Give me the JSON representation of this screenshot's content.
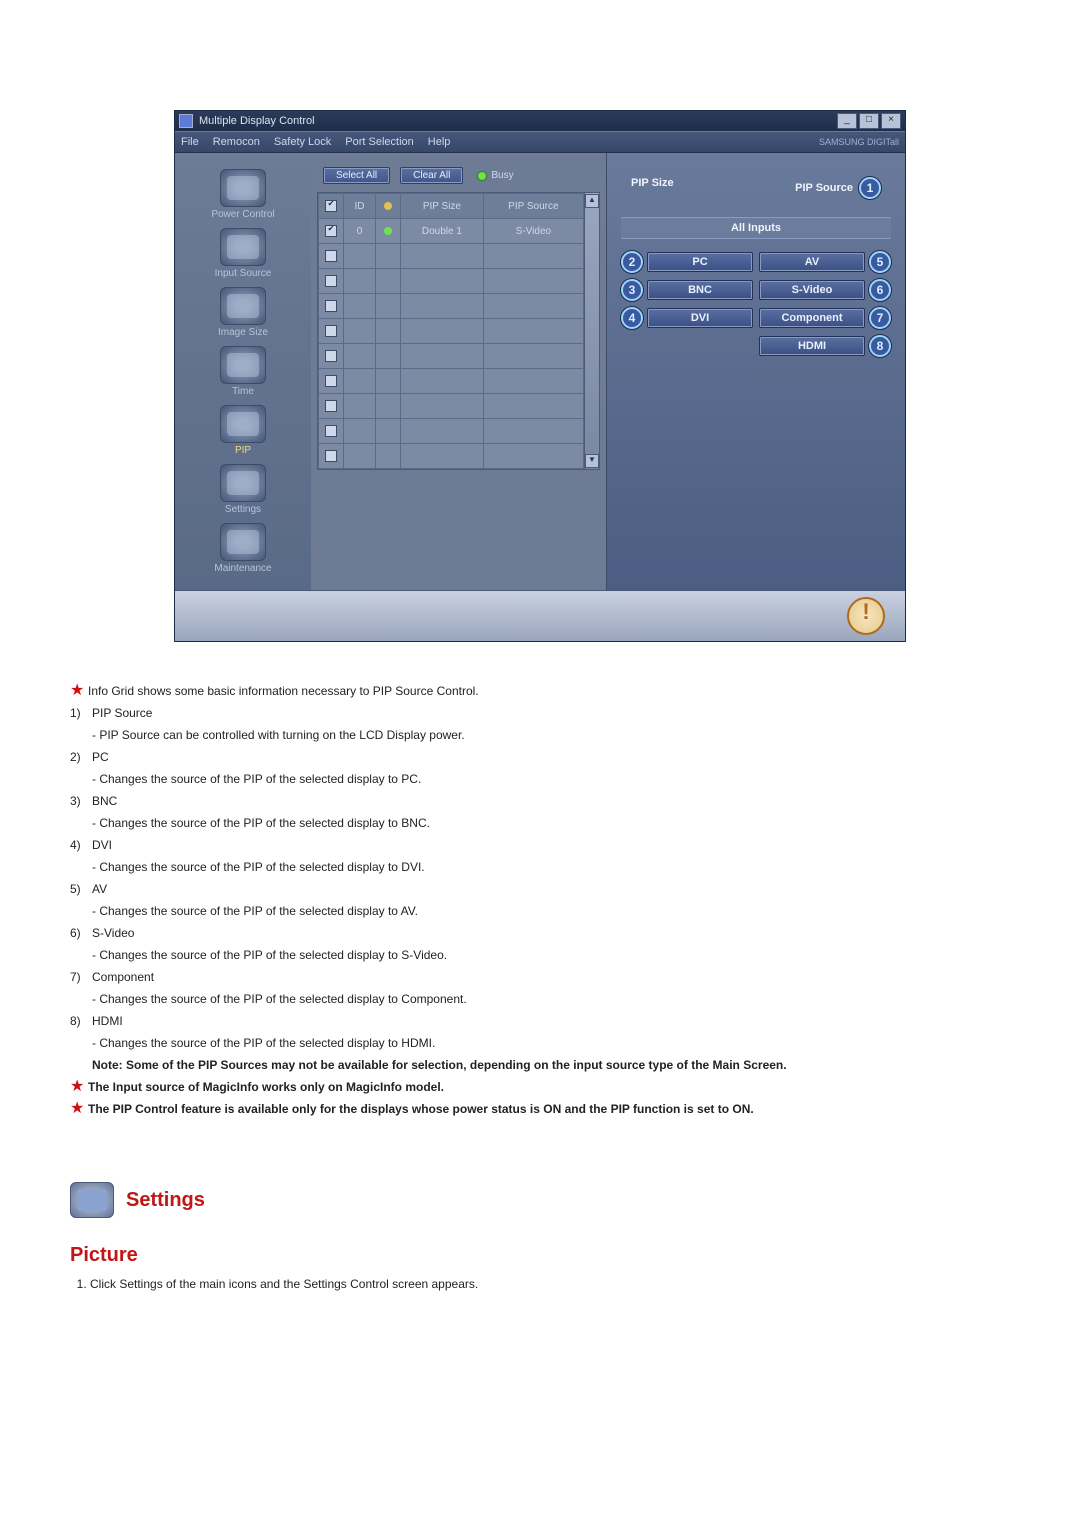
{
  "app": {
    "title": "Multiple Display Control",
    "menus": [
      "File",
      "Remocon",
      "Safety Lock",
      "Port Selection",
      "Help"
    ],
    "brand": "SAMSUNG DIGITall"
  },
  "sidebar": {
    "items": [
      {
        "label": "Power Control"
      },
      {
        "label": "Input Source"
      },
      {
        "label": "Image Size"
      },
      {
        "label": "Time"
      },
      {
        "label": "PIP"
      },
      {
        "label": "Settings"
      },
      {
        "label": "Maintenance"
      }
    ]
  },
  "toolbar": {
    "select_all": "Select All",
    "clear_all": "Clear All",
    "busy": "Busy"
  },
  "grid": {
    "headers": [
      "",
      "ID",
      "",
      "PIP Size",
      "PIP Source"
    ],
    "rows": [
      {
        "checked": true,
        "id": "0",
        "status": "green",
        "size": "Double 1",
        "source": "S-Video"
      },
      {
        "checked": false,
        "id": "",
        "status": "",
        "size": "",
        "source": ""
      },
      {
        "checked": false,
        "id": "",
        "status": "",
        "size": "",
        "source": ""
      },
      {
        "checked": false,
        "id": "",
        "status": "",
        "size": "",
        "source": ""
      },
      {
        "checked": false,
        "id": "",
        "status": "",
        "size": "",
        "source": ""
      },
      {
        "checked": false,
        "id": "",
        "status": "",
        "size": "",
        "source": ""
      },
      {
        "checked": false,
        "id": "",
        "status": "",
        "size": "",
        "source": ""
      },
      {
        "checked": false,
        "id": "",
        "status": "",
        "size": "",
        "source": ""
      },
      {
        "checked": false,
        "id": "",
        "status": "",
        "size": "",
        "source": ""
      },
      {
        "checked": false,
        "id": "",
        "status": "",
        "size": "",
        "source": ""
      }
    ]
  },
  "right": {
    "head_left": "PIP Size",
    "head_right": "PIP Source",
    "all_inputs": "All Inputs",
    "callouts": {
      "c1": "1",
      "c2": "2",
      "c3": "3",
      "c4": "4",
      "c5": "5",
      "c6": "6",
      "c7": "7",
      "c8": "8"
    },
    "buttons": {
      "pc": "PC",
      "av": "AV",
      "bnc": "BNC",
      "svideo": "S-Video",
      "dvi": "DVI",
      "component": "Component",
      "hdmi": "HDMI"
    }
  },
  "doc": {
    "intro": "Info Grid shows some basic information necessary to PIP Source Control.",
    "items": [
      {
        "num": "1)",
        "title": "PIP Source",
        "desc": "- PIP Source can be controlled with turning on the LCD Display power."
      },
      {
        "num": "2)",
        "title": "PC",
        "desc": "- Changes the source of the PIP of the selected display to PC."
      },
      {
        "num": "3)",
        "title": "BNC",
        "desc": "- Changes the source of the PIP of the selected display to BNC."
      },
      {
        "num": "4)",
        "title": "DVI",
        "desc": "- Changes the source of the PIP of the selected display to DVI."
      },
      {
        "num": "5)",
        "title": "AV",
        "desc": "- Changes the source of the PIP of the selected display to AV."
      },
      {
        "num": "6)",
        "title": "S-Video",
        "desc": "- Changes the source of the PIP of the selected display to S-Video."
      },
      {
        "num": "7)",
        "title": "Component",
        "desc": "- Changes the source of the PIP of the selected display to Component."
      },
      {
        "num": "8)",
        "title": "HDMI",
        "desc": "- Changes the source of the PIP of the selected display to HDMI."
      }
    ],
    "note_sources": "Note: Some of the PIP Sources may not be available for selection, depending on the input source type of the Main Screen.",
    "note_magic": "The Input source of MagicInfo works only on MagicInfo model.",
    "note_pip": "The PIP Control feature is available only for the displays whose power status is ON and the PIP function is set to ON.",
    "section_settings": "Settings",
    "section_picture": "Picture",
    "picture_step1": "Click Settings of the main icons and the Settings Control screen appears."
  }
}
